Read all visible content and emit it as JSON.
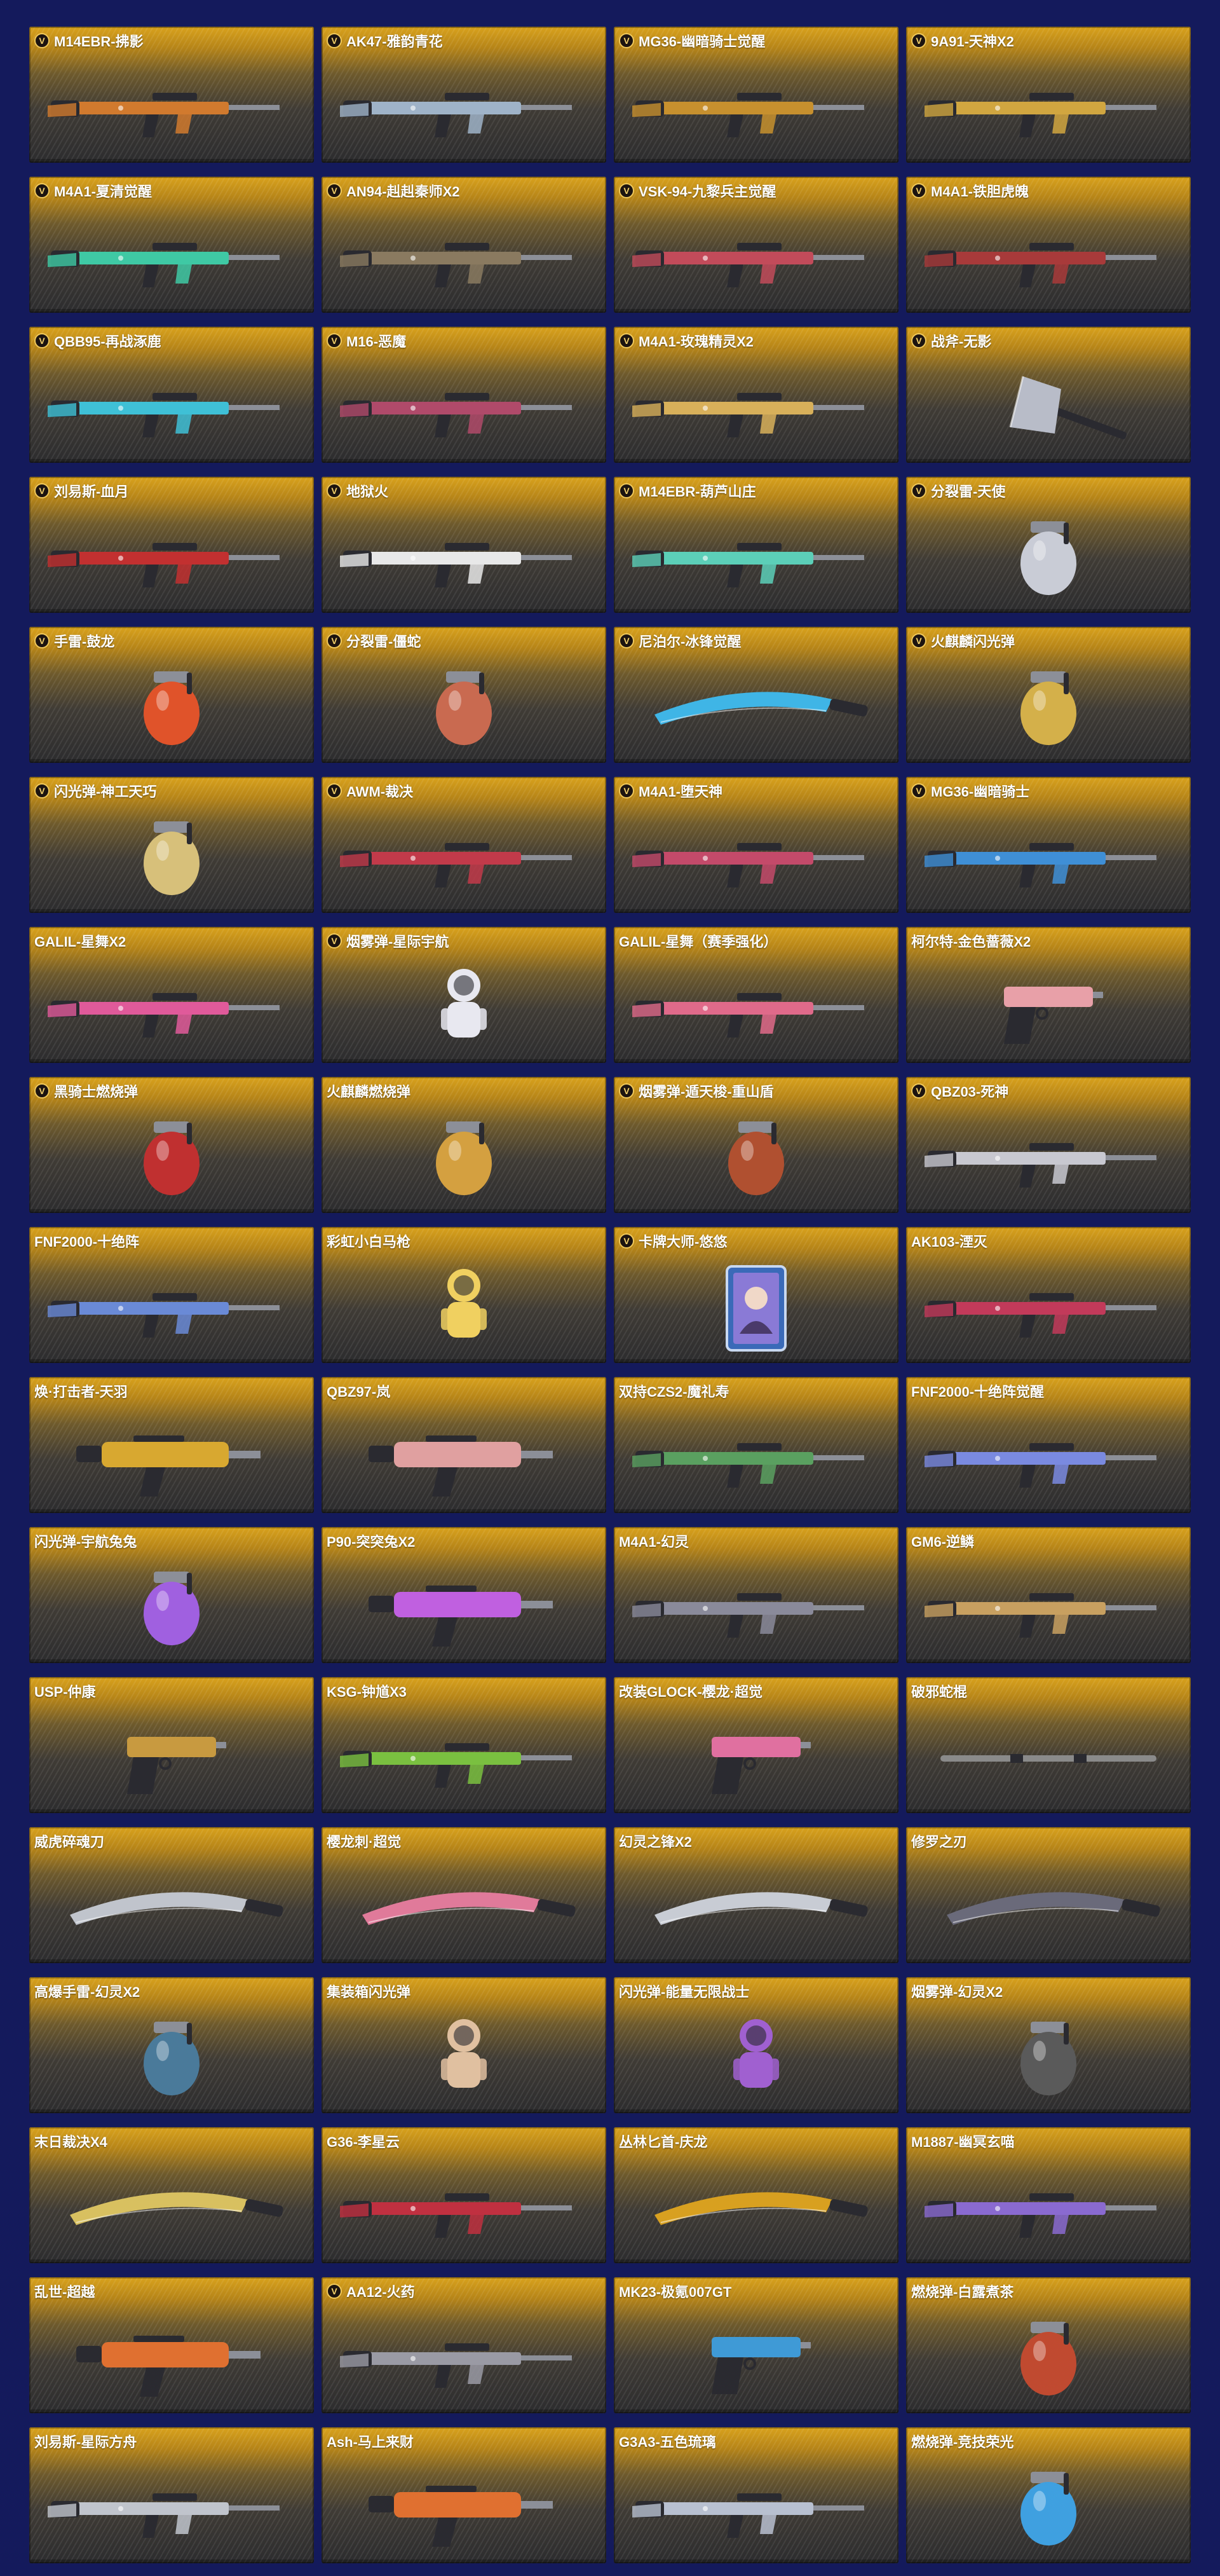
{
  "items": [
    {
      "name": "M14EBR-拂影",
      "badge": true,
      "icon": "rifle-icon",
      "accent": "#d17a2e"
    },
    {
      "name": "AK47-雅韵青花",
      "badge": true,
      "icon": "rifle-icon",
      "accent": "#9fb3c8"
    },
    {
      "name": "MG36-幽暗骑士觉醒",
      "badge": true,
      "icon": "rifle-icon",
      "accent": "#c7902e"
    },
    {
      "name": "9A91-天神X2",
      "badge": true,
      "icon": "rifle-icon",
      "accent": "#d1a640"
    },
    {
      "name": "M4A1-夏清觉醒",
      "badge": true,
      "icon": "rifle-icon",
      "accent": "#3fc9a4"
    },
    {
      "name": "AN94-赳赳秦师X2",
      "badge": true,
      "icon": "rifle-icon",
      "accent": "#8a7a60"
    },
    {
      "name": "VSK-94-九黎兵主觉醒",
      "badge": true,
      "icon": "rifle-icon",
      "accent": "#c24b5a"
    },
    {
      "name": "M4A1-铁胆虎魄",
      "badge": true,
      "icon": "rifle-icon",
      "accent": "#a83a3a"
    },
    {
      "name": "QBB95-再战涿鹿",
      "badge": true,
      "icon": "rifle-icon",
      "accent": "#3fc0d6"
    },
    {
      "name": "M16-恶魔",
      "badge": true,
      "icon": "rifle-icon",
      "accent": "#b04a6a"
    },
    {
      "name": "M4A1-玫瑰精灵X2",
      "badge": true,
      "icon": "rifle-icon",
      "accent": "#d8b05a"
    },
    {
      "name": "战斧-无影",
      "badge": true,
      "icon": "axe-icon",
      "accent": "#b8bcc8"
    },
    {
      "name": "刘易斯-血月",
      "badge": true,
      "icon": "rifle-icon",
      "accent": "#c23030"
    },
    {
      "name": "地狱火",
      "badge": true,
      "icon": "rifle-icon",
      "accent": "#e8e8e8"
    },
    {
      "name": "M14EBR-葫芦山庄",
      "badge": true,
      "icon": "rifle-icon",
      "accent": "#5ccfb8"
    },
    {
      "name": "分裂雷-天使",
      "badge": true,
      "icon": "grenade-icon",
      "accent": "#c9ccd6"
    },
    {
      "name": "手雷-鼓龙",
      "badge": true,
      "icon": "grenade-icon",
      "accent": "#e0532a"
    },
    {
      "name": "分裂雷-僵蛇",
      "badge": true,
      "icon": "grenade-icon",
      "accent": "#c96a50"
    },
    {
      "name": "尼泊尔-冰锋觉醒",
      "badge": true,
      "icon": "blade-icon",
      "accent": "#3fb5e6"
    },
    {
      "name": "火麒麟闪光弹",
      "badge": true,
      "icon": "grenade-icon",
      "accent": "#d4b04a"
    },
    {
      "name": "闪光弹-神工天巧",
      "badge": true,
      "icon": "grenade-icon",
      "accent": "#d7c07a"
    },
    {
      "name": "AWM-裁决",
      "badge": true,
      "icon": "rifle-icon",
      "accent": "#c23a4a"
    },
    {
      "name": "M4A1-堕天神",
      "badge": true,
      "icon": "rifle-icon",
      "accent": "#c44a6a"
    },
    {
      "name": "MG36-幽暗骑士",
      "badge": true,
      "icon": "rifle-icon",
      "accent": "#3f8fd6"
    },
    {
      "name": "GALIL-星舞X2",
      "badge": false,
      "icon": "rifle-icon",
      "accent": "#e05a9a"
    },
    {
      "name": "烟雾弹-星际宇航",
      "badge": true,
      "icon": "figure-icon",
      "accent": "#e8e8f0"
    },
    {
      "name": "GALIL-星舞（赛季强化）",
      "badge": false,
      "icon": "rifle-icon",
      "accent": "#e06a8a"
    },
    {
      "name": "柯尔特-金色蔷薇X2",
      "badge": false,
      "icon": "pistol-icon",
      "accent": "#e8a0a8"
    },
    {
      "name": "黑骑士燃烧弹",
      "badge": true,
      "icon": "grenade-icon",
      "accent": "#c03030"
    },
    {
      "name": "火麒麟燃烧弹",
      "badge": false,
      "icon": "grenade-icon",
      "accent": "#d4a040"
    },
    {
      "name": "烟雾弹-遁天梭-重山盾",
      "badge": true,
      "icon": "grenade-icon",
      "accent": "#b05030"
    },
    {
      "name": "QBZ03-死神",
      "badge": true,
      "icon": "rifle-icon",
      "accent": "#c8c8d0"
    },
    {
      "name": "FNF2000-十绝阵",
      "badge": false,
      "icon": "rifle-icon",
      "accent": "#6a8ad6"
    },
    {
      "name": "彩虹小白马枪",
      "badge": false,
      "icon": "figure-icon",
      "accent": "#f0d060"
    },
    {
      "name": "卡牌大师-悠悠",
      "badge": true,
      "icon": "card-icon",
      "accent": "#8a7ad6"
    },
    {
      "name": "AK103-湮灭",
      "badge": false,
      "icon": "rifle-icon",
      "accent": "#c23a5a"
    },
    {
      "name": "焕·打击者-天羽",
      "badge": false,
      "icon": "smg-icon",
      "accent": "#d8a830"
    },
    {
      "name": "QBZ97-岚",
      "badge": false,
      "icon": "smg-icon",
      "accent": "#e0a0a0"
    },
    {
      "name": "双持CZS2-魔礼寿",
      "badge": false,
      "icon": "rifle-icon",
      "accent": "#5aa060"
    },
    {
      "name": "FNF2000-十绝阵觉醒",
      "badge": false,
      "icon": "rifle-icon",
      "accent": "#7a8ae0"
    },
    {
      "name": "闪光弹-宇航兔兔",
      "badge": false,
      "icon": "grenade-icon",
      "accent": "#a060e0"
    },
    {
      "name": "P90-突突兔X2",
      "badge": false,
      "icon": "smg-icon",
      "accent": "#c060e0"
    },
    {
      "name": "M4A1-幻灵",
      "badge": false,
      "icon": "rifle-icon",
      "accent": "#8a8a9a"
    },
    {
      "name": "GM6-逆鳞",
      "badge": false,
      "icon": "rifle-icon",
      "accent": "#c8a060"
    },
    {
      "name": "USP-仲康",
      "badge": false,
      "icon": "pistol-icon",
      "accent": "#c89a40"
    },
    {
      "name": "KSG-钟馗X3",
      "badge": false,
      "icon": "rifle-icon",
      "accent": "#7ac040"
    },
    {
      "name": "改装GLOCK-樱龙·超觉",
      "badge": false,
      "icon": "pistol-icon",
      "accent": "#e070a0"
    },
    {
      "name": "破邪蛇棍",
      "badge": false,
      "icon": "staff-icon",
      "accent": "#8a8a8a"
    },
    {
      "name": "威虎碎魂刀",
      "badge": false,
      "icon": "blade-icon",
      "accent": "#c0c4cc"
    },
    {
      "name": "樱龙刺·超觉",
      "badge": false,
      "icon": "blade-icon",
      "accent": "#e07a9a"
    },
    {
      "name": "幻灵之锋X2",
      "badge": false,
      "icon": "blade-icon",
      "accent": "#c8ccd4"
    },
    {
      "name": "修罗之刃",
      "badge": false,
      "icon": "blade-icon",
      "accent": "#6a6a7a"
    },
    {
      "name": "高爆手雷-幻灵X2",
      "badge": false,
      "icon": "grenade-icon",
      "accent": "#4a7a9a"
    },
    {
      "name": "集装箱闪光弹",
      "badge": false,
      "icon": "figure-icon",
      "accent": "#e0c0a0"
    },
    {
      "name": "闪光弹-能量无限战士",
      "badge": false,
      "icon": "figure-icon",
      "accent": "#a060d0"
    },
    {
      "name": "烟雾弹-幻灵X2",
      "badge": false,
      "icon": "grenade-icon",
      "accent": "#5a5a5a"
    },
    {
      "name": "末日裁决X4",
      "badge": false,
      "icon": "blade-icon",
      "accent": "#d8c060"
    },
    {
      "name": "G36-李星云",
      "badge": false,
      "icon": "rifle-icon",
      "accent": "#c03040"
    },
    {
      "name": "丛林匕首-庆龙",
      "badge": false,
      "icon": "blade-icon",
      "accent": "#d8a020"
    },
    {
      "name": "M1887-幽冥玄喵",
      "badge": false,
      "icon": "rifle-icon",
      "accent": "#8a6ad0"
    },
    {
      "name": "乱世-超越",
      "badge": false,
      "icon": "smg-icon",
      "accent": "#e07030"
    },
    {
      "name": "AA12-火药",
      "badge": true,
      "icon": "rifle-icon",
      "accent": "#9a9aa4"
    },
    {
      "name": "MK23-极氪007GT",
      "badge": false,
      "icon": "pistol-icon",
      "accent": "#3f9ad6"
    },
    {
      "name": "燃烧弹-白露煮茶",
      "badge": false,
      "icon": "grenade-icon",
      "accent": "#c04a30"
    },
    {
      "name": "刘易斯-星际方舟",
      "badge": false,
      "icon": "rifle-icon",
      "accent": "#c0c4cc"
    },
    {
      "name": "Ash-马上来财",
      "badge": false,
      "icon": "smg-icon",
      "accent": "#e07030"
    },
    {
      "name": "G3A3-五色琉璃",
      "badge": false,
      "icon": "rifle-icon",
      "accent": "#b8c0d0"
    },
    {
      "name": "燃烧弹-竞技荣光",
      "badge": false,
      "icon": "grenade-icon",
      "accent": "#3fa0e0"
    }
  ]
}
